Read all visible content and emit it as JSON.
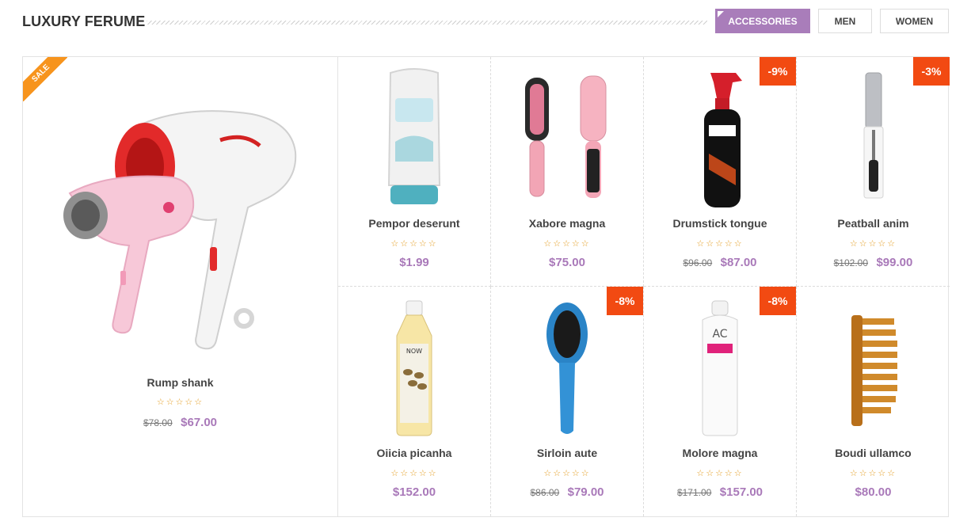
{
  "header": {
    "title": "LUXURY FERUME",
    "tabs": [
      {
        "label": "ACCESSORIES",
        "active": true
      },
      {
        "label": "MEN",
        "active": false
      },
      {
        "label": "WOMEN",
        "active": false
      }
    ]
  },
  "colors": {
    "accent": "#a97dba",
    "price": "#a979b9",
    "discount_badge": "#f24a12",
    "sale_ribbon": "#f7941d",
    "stars": "#e39b1d"
  },
  "featured": {
    "name": "Rump shank",
    "badge": "SALE",
    "stars": "☆☆☆☆☆",
    "old_price": "$78.00",
    "price": "$67.00",
    "image": "hair-dryer-icon"
  },
  "products": [
    {
      "name": "Pempor deserunt",
      "stars": "☆☆☆☆☆",
      "price": "$1.99",
      "image": "conditioner-bottle-icon"
    },
    {
      "name": "Xabore magna",
      "stars": "☆☆☆☆☆",
      "price": "$75.00",
      "image": "straightening-brush-icon"
    },
    {
      "name": "Drumstick tongue",
      "stars": "☆☆☆☆☆",
      "old_price": "$96.00",
      "price": "$87.00",
      "discount": "-9%",
      "image": "spray-bottle-icon"
    },
    {
      "name": "Peatball anim",
      "stars": "☆☆☆☆☆",
      "old_price": "$102.00",
      "price": "$99.00",
      "discount": "-3%",
      "image": "mascara-icon"
    },
    {
      "name": "Oiicia picanha",
      "stars": "☆☆☆☆☆",
      "price": "$152.00",
      "image": "oil-bottle-icon"
    },
    {
      "name": "Sirloin aute",
      "stars": "☆☆☆☆☆",
      "old_price": "$86.00",
      "price": "$79.00",
      "discount": "-8%",
      "image": "paddle-brush-icon"
    },
    {
      "name": "Molore magna",
      "stars": "☆☆☆☆☆",
      "old_price": "$171.00",
      "price": "$157.00",
      "discount": "-8%",
      "image": "shampoo-bottle-icon"
    },
    {
      "name": "Boudi ullamco",
      "stars": "☆☆☆☆☆",
      "price": "$80.00",
      "image": "comb-icon"
    }
  ]
}
